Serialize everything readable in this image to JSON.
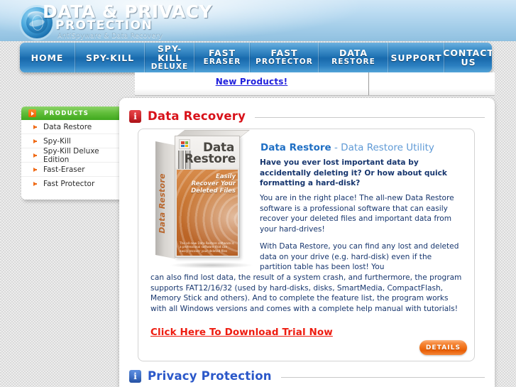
{
  "header": {
    "logo_icon": "globe-icon",
    "title": "DATA & PRIVACY",
    "subtitle": "PROTECTION",
    "tagline": "AntiSpyware & Data Recovery"
  },
  "nav": {
    "items": [
      {
        "label": "HOME",
        "sub": ""
      },
      {
        "label": "SPY-KILL",
        "sub": ""
      },
      {
        "label": "SPY-KILL",
        "sub": "DELUXE"
      },
      {
        "label": "FAST",
        "sub": "ERASER"
      },
      {
        "label": "FAST",
        "sub": "PROTECTOR"
      },
      {
        "label": "DATA",
        "sub": "RESTORE"
      },
      {
        "label": "SUPPORT",
        "sub": ""
      },
      {
        "label": "CONTACT US",
        "sub": ""
      }
    ]
  },
  "top_strip": {
    "new_products_label": "New Products!"
  },
  "sidebar": {
    "header_label": "PRODUCTS",
    "header_icon": "orange-arrow-icon",
    "items": [
      {
        "label": "Data Restore"
      },
      {
        "label": "Spy-Kill"
      },
      {
        "label": "Spy-Kill Deluxe Edition"
      },
      {
        "label": "Fast-Eraser"
      },
      {
        "label": "Fast Protector"
      }
    ]
  },
  "main": {
    "sections": [
      {
        "icon": "info-icon",
        "heading": "Data Recovery",
        "color": "#d8121a"
      },
      {
        "icon": "info-icon",
        "heading": "Privacy Protection",
        "color": "#2b58c9"
      }
    ],
    "product": {
      "box_art": {
        "top_line": "Data",
        "bottom_line": "Restore",
        "spine_text": "Data Restore",
        "tagline_line1": "Easily",
        "tagline_line2": "Recover Your",
        "tagline_line3": "Deleted Files",
        "blurb": "The all-new Data Restore software is a professional software that can easily recover your deleted files"
      },
      "title": "Data Restore",
      "title_suffix": " - Data Restore Utility",
      "lead": "Have you ever lost important data by accidentally deleting it? Or how about quick formatting a hard-disk?",
      "paragraph_2": "You are in the right place! The all-new Data Restore software is a professional software that can easily recover your deleted files and important data from your hard-drives!",
      "paragraph_3_inset": "With Data Restore, you can find any lost and deleted data on your drive (e.g. hard-disk) even if the partition table has been lost! You",
      "paragraph_3_full": "can also find lost data, the result of a system crash, and furthermore, the program supports FAT12/16/32 (used by hard-disks, disks, SmartMedia, CompactFlash, Memory Stick and others). And to complete the feature list, the program works with all Windows versions and comes with a complete help manual with tutorials!",
      "download_link": "Click Here To Download Trial Now",
      "details_button": "DETAILS"
    }
  },
  "colors": {
    "nav_blue": "#1769ac",
    "sidebar_green": "#3fa81d",
    "accent_orange": "#ef6a16",
    "heading_red": "#d8121a",
    "heading_blue": "#2b58c9",
    "link_blue": "#2222dd",
    "link_red": "#ee1c10"
  }
}
